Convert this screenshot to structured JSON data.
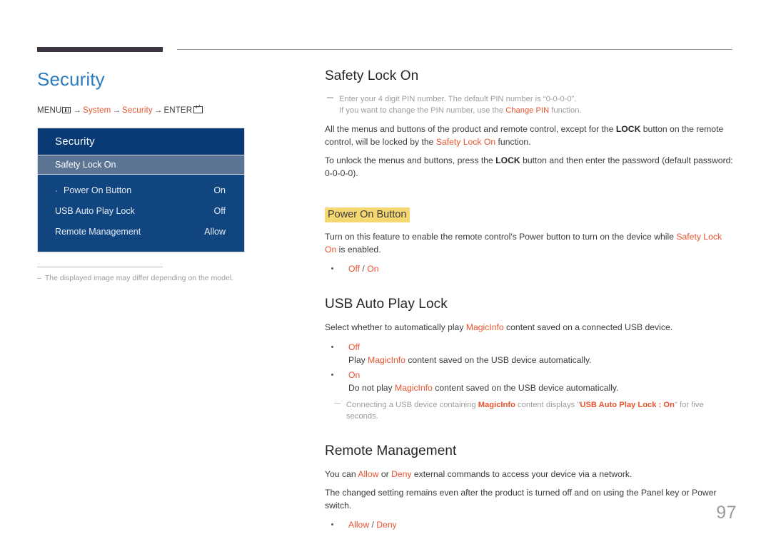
{
  "page": {
    "number": "97"
  },
  "left": {
    "title": "Security",
    "breadcrumb": {
      "menu_label": "MENU",
      "menu_icon": "menu-grid-icon",
      "arrow": "→",
      "item1": "System",
      "item2": "Security",
      "enter_label": "ENTER",
      "enter_icon": "enter-key-icon"
    },
    "osd": {
      "title": "Security",
      "rows": [
        {
          "label": "Safety Lock On",
          "value": "",
          "selected": true,
          "sub": false
        },
        {
          "label": "Power On Button",
          "value": "On",
          "selected": false,
          "sub": true,
          "marker": "·"
        },
        {
          "label": "USB Auto Play Lock",
          "value": "Off",
          "selected": false,
          "sub": false
        },
        {
          "label": "Remote Management",
          "value": "Allow",
          "selected": false,
          "sub": false
        }
      ]
    },
    "note": {
      "dash": "–",
      "text": "The displayed image may differ depending on the model."
    }
  },
  "right": {
    "sections": [
      {
        "id": "safety-lock-on",
        "heading": "Safety Lock On",
        "heading_style": "plain",
        "note": {
          "line1_a": "Enter your 4 digit PIN number. The default PIN number is “0-0-0-0”.",
          "line2_a": "If you want to change the PIN number, use the ",
          "line2_accent": "Change PIN",
          "line2_b": " function."
        },
        "paragraphs": [
          {
            "parts": [
              {
                "t": "All the menus and buttons of the product and remote control, except for the ",
                "s": "plain"
              },
              {
                "t": "LOCK",
                "s": "strong"
              },
              {
                "t": " button on the remote control, will be locked by the ",
                "s": "plain"
              },
              {
                "t": "Safety Lock On",
                "s": "accent"
              },
              {
                "t": " function.",
                "s": "plain"
              }
            ]
          },
          {
            "parts": [
              {
                "t": "To unlock the menus and buttons, press the ",
                "s": "plain"
              },
              {
                "t": "LOCK",
                "s": "strong"
              },
              {
                "t": " button and then enter the password (default password: 0-0-0-0).",
                "s": "plain"
              }
            ]
          }
        ]
      },
      {
        "id": "power-on-button",
        "heading": "Power On Button",
        "heading_style": "highlight",
        "paragraphs": [
          {
            "parts": [
              {
                "t": "Turn on this feature to enable the remote control's Power button to turn on the device while ",
                "s": "plain"
              },
              {
                "t": "Safety Lock On",
                "s": "accent"
              },
              {
                "t": " is enabled.",
                "s": "plain"
              }
            ]
          }
        ],
        "options": [
          {
            "option": "Off",
            "separator": " / ",
            "option2": "On"
          }
        ]
      },
      {
        "id": "usb-auto-play-lock",
        "heading": "USB Auto Play Lock",
        "heading_style": "plain",
        "paragraphs": [
          {
            "parts": [
              {
                "t": "Select whether to automatically play ",
                "s": "plain"
              },
              {
                "t": "MagicInfo",
                "s": "accent"
              },
              {
                "t": " content saved on a connected USB device.",
                "s": "plain"
              }
            ]
          }
        ],
        "option_items": [
          {
            "option": "Off",
            "desc_parts": [
              {
                "t": "Play ",
                "s": "plain"
              },
              {
                "t": "MagicInfo",
                "s": "accent"
              },
              {
                "t": " content saved on the USB device automatically.",
                "s": "plain"
              }
            ]
          },
          {
            "option": "On",
            "desc_parts": [
              {
                "t": "Do not play ",
                "s": "plain"
              },
              {
                "t": "MagicInfo",
                "s": "accent"
              },
              {
                "t": " content saved on the USB device automatically.",
                "s": "plain"
              }
            ]
          }
        ],
        "trailing_note": {
          "parts": [
            {
              "t": "Connecting a USB device containing ",
              "s": "plain"
            },
            {
              "t": "MagicInfo",
              "s": "accent-b"
            },
            {
              "t": " content displays \"",
              "s": "plain"
            },
            {
              "t": "USB Auto Play Lock : On",
              "s": "accent-b"
            },
            {
              "t": "\" for five seconds.",
              "s": "plain"
            }
          ]
        }
      },
      {
        "id": "remote-management",
        "heading": "Remote Management",
        "heading_style": "plain",
        "paragraphs": [
          {
            "parts": [
              {
                "t": "You can ",
                "s": "plain"
              },
              {
                "t": "Allow",
                "s": "accent"
              },
              {
                "t": " or ",
                "s": "plain"
              },
              {
                "t": "Deny",
                "s": "accent"
              },
              {
                "t": " external commands to access your device via a network.",
                "s": "plain"
              }
            ]
          },
          {
            "parts": [
              {
                "t": "The changed setting remains even after the product is turned off and on using the Panel key or Power switch.",
                "s": "plain"
              }
            ]
          }
        ],
        "options": [
          {
            "option": "Allow",
            "separator": " / ",
            "option2": "Deny"
          }
        ]
      }
    ]
  },
  "colors": {
    "accent": "#e8542f",
    "title_blue": "#2b7cc0",
    "osd_header": "#0a3a75",
    "osd_body": "#11457f",
    "osd_selected": "#5c7594",
    "highlight": "#f6d873",
    "rule_dark": "#3d3341"
  }
}
